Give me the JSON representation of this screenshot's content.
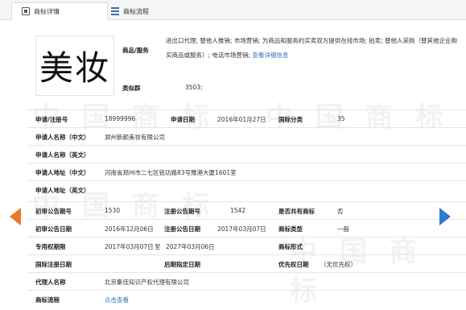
{
  "tabs": [
    {
      "label": "商标详情",
      "active": true
    },
    {
      "label": "商标流程",
      "active": false
    }
  ],
  "mark": {
    "text": "美妆"
  },
  "services": {
    "label": "商品/服务",
    "text": "进出口代理; 替他人推销; 市场营销; 为商品和服务的买卖双方提供在线市场; 拍卖; 替他人采购（替其他企业购买商品或服务）; 电话市场营销;",
    "link": "查看详细信息"
  },
  "similar_group": {
    "label": "类似群",
    "value": "3503;"
  },
  "fields": {
    "reg_no_label": "申请/注册号",
    "reg_no": "18999996",
    "apply_date_label": "申请日期",
    "apply_date": "2016年01月27日",
    "intl_class_label": "国际分类",
    "intl_class": "35",
    "applicant_cn_label": "申请人名称（中文）",
    "applicant_cn": "郑州新颜美妆有限公司",
    "applicant_en_label": "申请人名称（英文）",
    "applicant_en": "",
    "address_cn_label": "申请人地址（中文）",
    "address_cn": "河南省郑州市二七区铭功路83号豫港大厦1601室",
    "address_en_label": "申请人地址（英文）",
    "address_en": "",
    "prelim_pub_no_label": "初审公告期号",
    "prelim_pub_no": "1530",
    "reg_pub_no_label": "注册公告期号",
    "reg_pub_no": "1542",
    "shared_label": "是否共有商标",
    "shared": "否",
    "prelim_pub_date_label": "初审公告日期",
    "prelim_pub_date": "2016年12月06日",
    "reg_pub_date_label": "注册公告日期",
    "reg_pub_date": "2017年03月07日",
    "mark_type_label": "商标类型",
    "mark_type": "一般",
    "exclusive_term_label": "专用权期限",
    "exclusive_start": "2017年03月07日",
    "exclusive_to": "至",
    "exclusive_end": "2027年03月06日",
    "mark_form_label": "商标形式",
    "mark_form": "",
    "intl_reg_date_label": "国际注册日期",
    "intl_reg_date": "",
    "later_date_label": "后期指定日期",
    "later_date": "",
    "priority_date_label": "优先权日期",
    "priority_date": "（无优先权）",
    "agent_label": "代理人名称",
    "agent": "北京集佳知识产权代理有限公司",
    "flow_label": "商标流程",
    "flow_link": "点击查看"
  },
  "watermark_text": "中国商标",
  "colors": {
    "link": "#2f6fb7",
    "prev_arrow": "#e8792b",
    "next_arrow": "#2f7bd3"
  }
}
